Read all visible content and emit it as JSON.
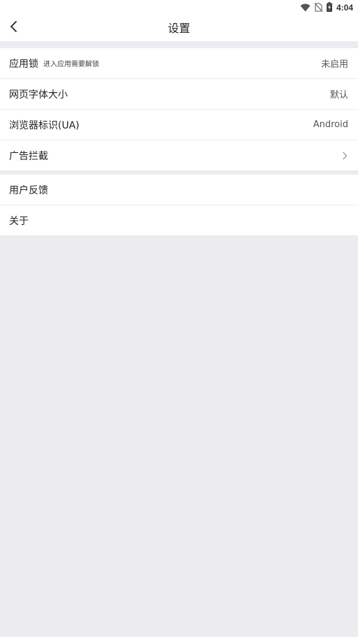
{
  "status_bar": {
    "time": "4:04",
    "icons": [
      "wifi-icon",
      "no-sim-icon",
      "battery-charging-icon"
    ]
  },
  "nav": {
    "title": "设置",
    "back_icon": "chevron-left-icon"
  },
  "group1": [
    {
      "label": "应用锁",
      "sublabel": "进入应用需要解锁",
      "value": "未启用"
    },
    {
      "label": "网页字体大小",
      "value": "默认"
    },
    {
      "label": "浏览器标识(UA)",
      "value": "Android"
    },
    {
      "label": "广告拦截",
      "icon": "chevron-right-icon"
    }
  ],
  "group2": [
    {
      "label": "用户反馈"
    },
    {
      "label": "关于"
    }
  ]
}
